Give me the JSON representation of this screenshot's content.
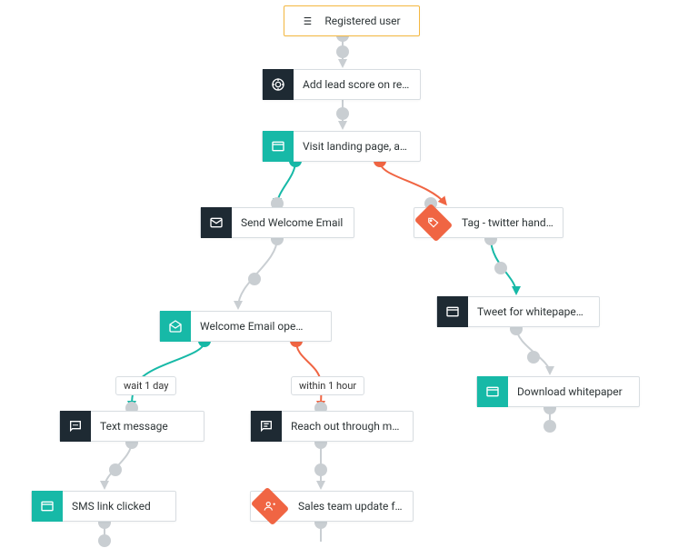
{
  "colors": {
    "teal": "#17b9a7",
    "orange": "#f06543",
    "dark": "#1e2a33",
    "gray": "#c9ced2",
    "start_border": "#f4b740"
  },
  "nodes": {
    "start": {
      "label": "Registered user",
      "icon": "list-icon"
    },
    "add_score": {
      "label": "Add lead score on reg…",
      "icon": "target-icon"
    },
    "visit_landing": {
      "label": "Visit landing page, ap…",
      "icon": "browser-icon"
    },
    "send_welcome": {
      "label": "Send Welcome Email",
      "icon": "mail-closed-icon"
    },
    "tag_twitter": {
      "label": "Tag - twitter handling",
      "icon": "tag-icon"
    },
    "welcome_opened": {
      "label": "Welcome Email opened",
      "icon": "mail-open-icon"
    },
    "tweet_whitepaper": {
      "label": "Tweet for whitepaper …",
      "icon": "browser-icon"
    },
    "download_whitepaper": {
      "label": "Download whitepaper",
      "icon": "browser-icon"
    },
    "text_message": {
      "label": "Text message",
      "icon": "chat-dots-icon"
    },
    "reach_out": {
      "label": "Reach out through mu…",
      "icon": "chat-lines-icon"
    },
    "sms_clicked": {
      "label": "SMS link clicked",
      "icon": "browser-icon"
    },
    "sales_update": {
      "label": "Sales team update for…",
      "icon": "user-plus-icon"
    }
  },
  "badges": {
    "wait1day": "wait 1 day",
    "within1hour": "within 1 hour"
  }
}
